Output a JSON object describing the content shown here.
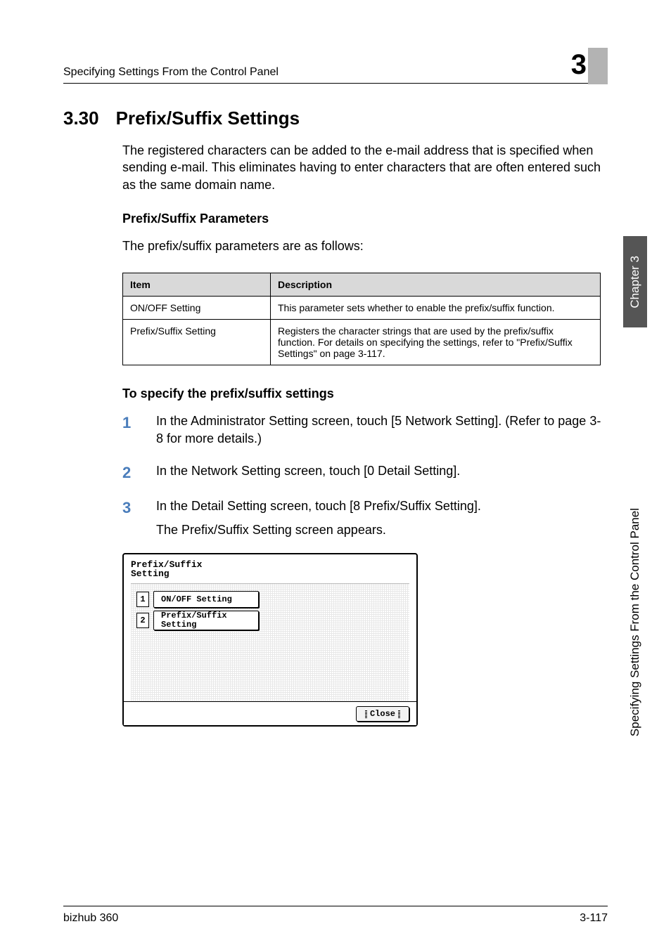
{
  "header": {
    "running_title": "Specifying Settings From the Control Panel",
    "chapter_number": "3"
  },
  "section": {
    "number": "3.30",
    "title": "Prefix/Suffix Settings",
    "intro": "The registered characters can be added to the e-mail address that is specified when sending e-mail. This eliminates having to enter characters that are often entered such as the same domain name."
  },
  "parameters": {
    "heading": "Prefix/Suffix Parameters",
    "lead": "The prefix/suffix parameters are as follows:",
    "columns": {
      "item": "Item",
      "description": "Description"
    },
    "rows": [
      {
        "item": "ON/OFF Setting",
        "description": "This parameter sets whether to enable the prefix/suffix function."
      },
      {
        "item": "Prefix/Suffix Setting",
        "description": "Registers the character strings that are used by the prefix/suffix function. For details on specifying the settings, refer to \"Prefix/Suffix Settings\" on page 3-117."
      }
    ]
  },
  "procedure": {
    "heading": "To specify the prefix/suffix settings",
    "steps": [
      {
        "n": "1",
        "text": "In the Administrator Setting screen, touch [5 Network Setting]. (Refer to page 3-8 for more details.)"
      },
      {
        "n": "2",
        "text": "In the Network Setting screen, touch [0 Detail Setting]."
      },
      {
        "n": "3",
        "text": "In the Detail Setting screen, touch [8 Prefix/Suffix Setting].",
        "sub": "The Prefix/Suffix Setting screen appears."
      }
    ]
  },
  "screenshot": {
    "title_line1": "Prefix/Suffix",
    "title_line2": "Setting",
    "buttons": [
      {
        "n": "1",
        "label": "ON/OFF Setting"
      },
      {
        "n": "2",
        "label": "Prefix/Suffix\nSetting"
      }
    ],
    "close": "Close"
  },
  "side": {
    "chapter_label": "Chapter 3",
    "section_label": "Specifying Settings From the Control Panel"
  },
  "footer": {
    "product": "bizhub 360",
    "page": "3-117"
  }
}
